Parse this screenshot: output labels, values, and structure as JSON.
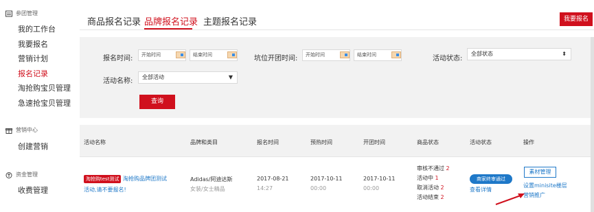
{
  "sidebar": {
    "sections": [
      {
        "title": "参团管理",
        "icon": "group-icon",
        "items": [
          "我的工作台",
          "我要报名",
          "营销计划",
          "报名记录",
          "淘抢购宝贝管理",
          "急速抢宝贝管理"
        ]
      },
      {
        "title": "营销中心",
        "icon": "gift-icon",
        "items": [
          "创建营销"
        ]
      },
      {
        "title": "资金管理",
        "icon": "money-icon",
        "items": [
          "收费管理"
        ]
      }
    ],
    "active_item": "报名记录"
  },
  "tabs": [
    "商品报名记录",
    "品牌报名记录",
    "主题报名记录"
  ],
  "active_tab": "品牌报名记录",
  "signup_button": "我要报名",
  "filter": {
    "signup_time_label": "报名时间:",
    "start_placeholder": "开始时间",
    "end_placeholder": "结束时间",
    "open_time_label": "坑位开团时间:",
    "status_label": "活动状态:",
    "status_value": "全部状态",
    "activity_label": "活动名称:",
    "activity_value": "全部活动",
    "query_button": "查询"
  },
  "table": {
    "headers": [
      "活动名称",
      "品牌和类目",
      "报名时间",
      "预热时间",
      "开团时间",
      "商品状态",
      "活动状态",
      "操作"
    ],
    "row": {
      "tag": "淘抢购test测试",
      "name_line1": "淘抢购品牌团测试",
      "name_line2": "活动,请不要报名!",
      "brand": "Adidas/阿迪达斯",
      "category": "女装/女士精品",
      "signup_date": "2017-08-21",
      "signup_time": "14:27",
      "preheat_date": "2017-10-11",
      "preheat_time": "00:00",
      "open_date": "2017-10-11",
      "open_time": "00:00",
      "goods_status": [
        {
          "label": "审核不通过",
          "count": "2"
        },
        {
          "label": "活动中",
          "count": "1"
        },
        {
          "label": "取消活动",
          "count": "2"
        },
        {
          "label": "活动结束",
          "count": "2"
        }
      ],
      "activity_status": "商家终审通过",
      "view_details": "查看详情",
      "ops": {
        "material_button": "素材管理",
        "minisite_link": "设置minisite楼层",
        "marketing_link": "营销推广"
      }
    }
  },
  "colors": {
    "accent": "#d0101d",
    "link": "#1e78c8",
    "panel": "#f2f2f2"
  }
}
